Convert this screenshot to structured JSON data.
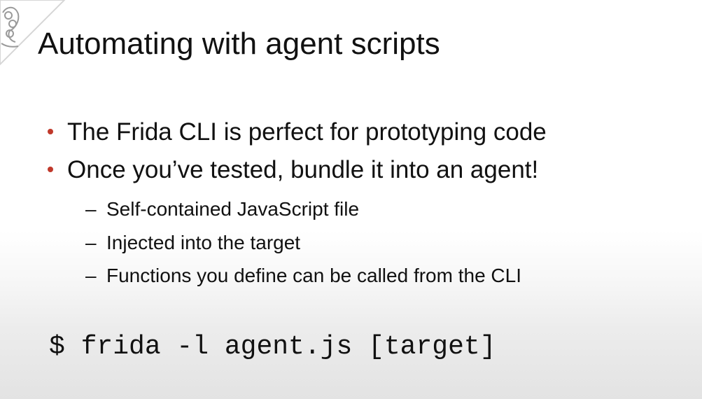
{
  "slide": {
    "title": "Automating with agent scripts",
    "bullets": [
      "The Frida CLI is perfect for prototyping code",
      "Once you’ve tested, bundle it into an agent!"
    ],
    "sub_bullets": [
      "Self-contained JavaScript file",
      "Injected into the target",
      "Functions you define can be called from the CLI"
    ],
    "sub_marker": "–",
    "command": "$ frida -l agent.js [target]"
  },
  "colors": {
    "bullet_accent": "#c0392b",
    "text": "#111111"
  },
  "icons": {
    "corner_logo": "caterpillar-logo-icon"
  }
}
